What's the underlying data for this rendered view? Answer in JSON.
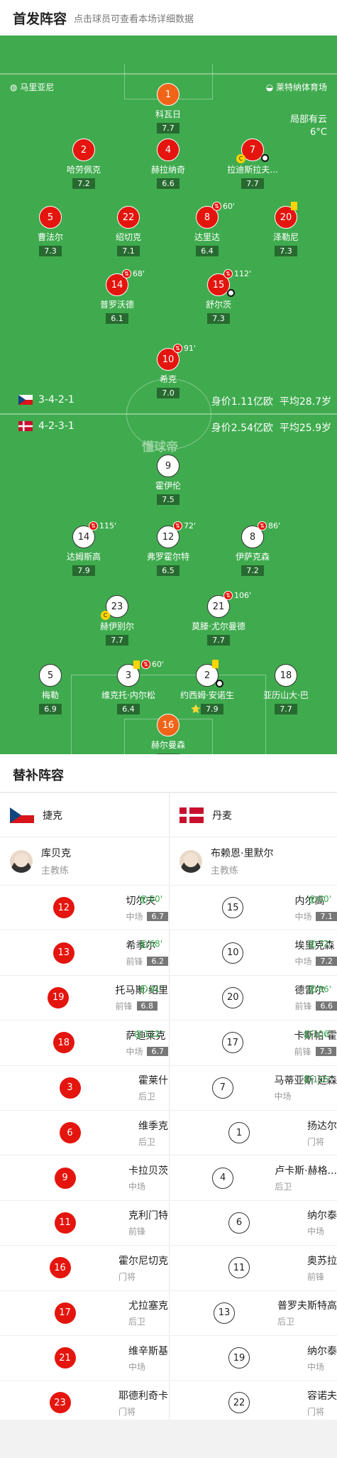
{
  "header": {
    "title": "首发阵容",
    "subtitle": "点击球员可查看本场详细数据"
  },
  "match": {
    "venue_left": "马里亚尼",
    "venue_right": "莱特纳体育场",
    "weather": "局部有云",
    "temperature": "6°C",
    "logo": "懂球帝"
  },
  "teams": {
    "home": {
      "formation": "3-4-2-1",
      "value": "身价1.11亿欧",
      "age": "平均28.7岁"
    },
    "away": {
      "formation": "4-2-3-1",
      "value": "身价2.54亿欧",
      "age": "平均25.9岁"
    }
  },
  "home_players": [
    {
      "num": "1",
      "name": "科瓦日",
      "rating": "7.7",
      "gk": true
    },
    {
      "num": "2",
      "name": "哈劳佩克",
      "rating": "7.2"
    },
    {
      "num": "4",
      "name": "赫拉纳奇",
      "rating": "6.6"
    },
    {
      "num": "7",
      "name": "拉迪斯拉夫...",
      "rating": "7.7",
      "cap": true,
      "ball": true
    },
    {
      "num": "5",
      "name": "曹法尔",
      "rating": "7.3"
    },
    {
      "num": "22",
      "name": "绍切克",
      "rating": "7.1"
    },
    {
      "num": "8",
      "name": "达里达",
      "rating": "6.4",
      "sub": "60'"
    },
    {
      "num": "20",
      "name": "泽勒尼",
      "rating": "7.3",
      "yellow": true
    },
    {
      "num": "14",
      "name": "普罗沃德",
      "rating": "6.1",
      "sub": "68'"
    },
    {
      "num": "15",
      "name": "舒尔茨",
      "rating": "7.3",
      "sub": "112'",
      "ball": true
    },
    {
      "num": "10",
      "name": "希克",
      "rating": "7.0",
      "sub": "91'"
    }
  ],
  "away_players": [
    {
      "num": "9",
      "name": "霍伊伦",
      "rating": "7.5"
    },
    {
      "num": "14",
      "name": "达姆斯高",
      "rating": "7.9",
      "sub": "115'"
    },
    {
      "num": "12",
      "name": "弗罗霍尔特",
      "rating": "6.5",
      "sub": "72'"
    },
    {
      "num": "8",
      "name": "伊萨克森",
      "rating": "7.2",
      "sub": "86'"
    },
    {
      "num": "23",
      "name": "赫伊别尔",
      "rating": "7.7",
      "cap": true
    },
    {
      "num": "21",
      "name": "莫滕·尤尔曼德",
      "rating": "7.7",
      "sub": "106'"
    },
    {
      "num": "5",
      "name": "梅勒",
      "rating": "6.9"
    },
    {
      "num": "3",
      "name": "维克托·内尔松",
      "rating": "6.4",
      "sub": "60'",
      "yellow": true
    },
    {
      "num": "2",
      "name": "约西姆·安诺生",
      "rating": "7.9",
      "yellow": true,
      "ball": true,
      "star": "⭐"
    },
    {
      "num": "18",
      "name": "亚历山大·巴",
      "rating": "7.7"
    },
    {
      "num": "16",
      "name": "赫尔曼森",
      "rating": "7.0",
      "gk": true
    }
  ],
  "subs": {
    "title": "替补阵容",
    "home": {
      "country": "捷克",
      "coach": "库贝克",
      "coach_role": "主教练",
      "list": [
        {
          "num": "12",
          "name": "切尔夫",
          "pos": "中场",
          "rating": "6.7",
          "ev": "60'"
        },
        {
          "num": "13",
          "name": "希季尔",
          "pos": "前锋",
          "rating": "6.2",
          "ev": "68'"
        },
        {
          "num": "19",
          "name": "托马斯·绍里",
          "pos": "前锋",
          "rating": "6.8",
          "ev": "91'"
        },
        {
          "num": "18",
          "name": "萨迪莱克",
          "pos": "中场",
          "rating": "6.7",
          "ev": "112'"
        },
        {
          "num": "3",
          "name": "霍莱什",
          "pos": "后卫"
        },
        {
          "num": "6",
          "name": "维季克",
          "pos": "后卫"
        },
        {
          "num": "9",
          "name": "卡拉贝茨",
          "pos": "中场"
        },
        {
          "num": "11",
          "name": "克利门特",
          "pos": "前锋"
        },
        {
          "num": "16",
          "name": "霍尔尼切克",
          "pos": "门将"
        },
        {
          "num": "17",
          "name": "尤拉塞克",
          "pos": "后卫"
        },
        {
          "num": "21",
          "name": "维辛斯基",
          "pos": "中场"
        },
        {
          "num": "23",
          "name": "耶德利奇卡",
          "pos": "门将"
        }
      ]
    },
    "away": {
      "country": "丹麦",
      "coach": "布赖恩·里默尔",
      "coach_role": "主教练",
      "list": [
        {
          "num": "15",
          "name": "内尔高",
          "pos": "中场",
          "rating": "7.1",
          "ev": "60'"
        },
        {
          "num": "10",
          "name": "埃里克森",
          "pos": "中场",
          "rating": "7.2",
          "ev": "72'"
        },
        {
          "num": "20",
          "name": "德雷尔",
          "pos": "前锋",
          "rating": "6.6",
          "ev": "86'"
        },
        {
          "num": "17",
          "name": "卡斯帕·霍",
          "pos": "前锋",
          "rating": "7.3",
          "ev": "106'"
        },
        {
          "num": "7",
          "name": "马蒂亚斯·延森",
          "pos": "中场",
          "ev": "115'"
        },
        {
          "num": "1",
          "name": "扬达尔",
          "pos": "门将"
        },
        {
          "num": "4",
          "name": "卢卡斯·赫格...",
          "pos": "后卫"
        },
        {
          "num": "6",
          "name": "纳尔泰",
          "pos": "中场"
        },
        {
          "num": "11",
          "name": "奥苏拉",
          "pos": "前锋"
        },
        {
          "num": "13",
          "name": "普罗夫斯特高",
          "pos": "后卫"
        },
        {
          "num": "19",
          "name": "纳尔泰",
          "pos": "中场"
        },
        {
          "num": "22",
          "name": "容诺夫",
          "pos": "门将"
        }
      ]
    }
  }
}
